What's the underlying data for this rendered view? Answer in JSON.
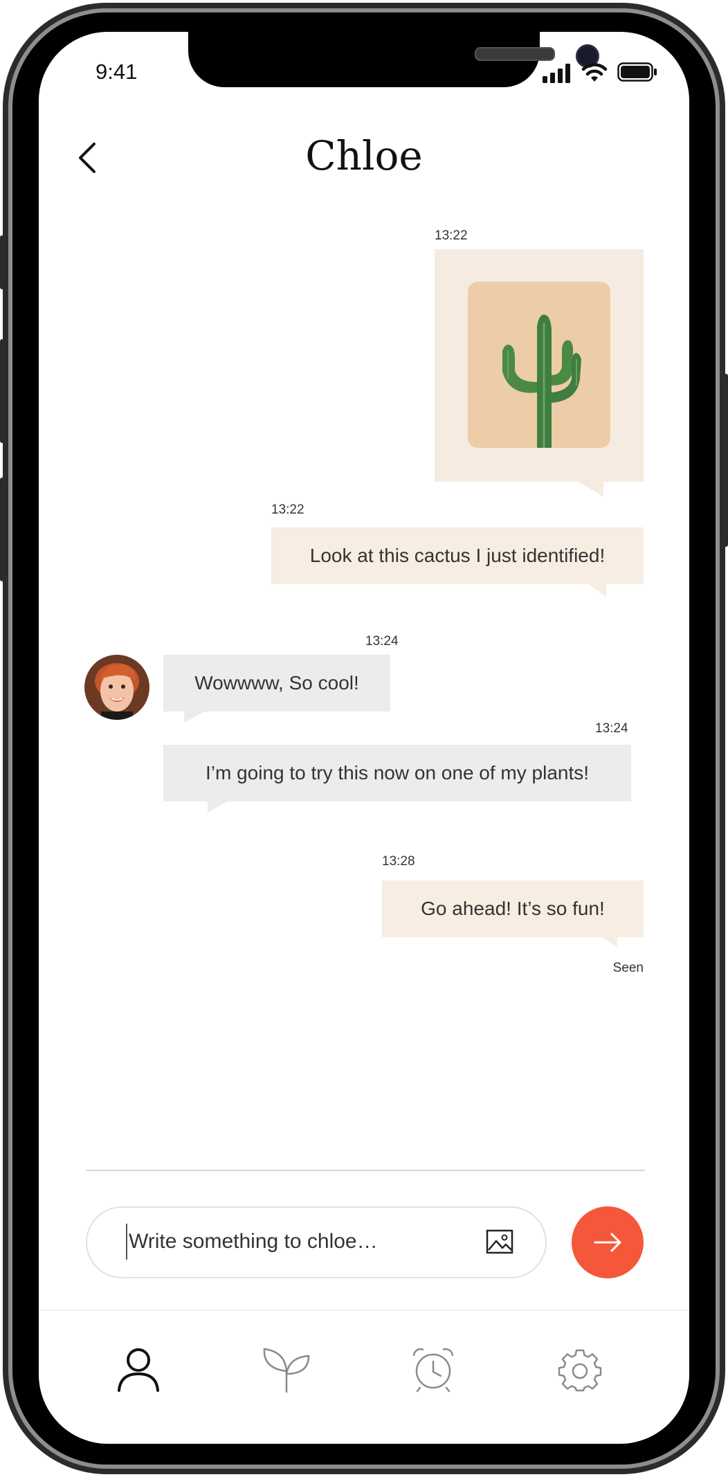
{
  "status_bar": {
    "time": "9:41"
  },
  "header": {
    "title": "Chloe",
    "back_icon": "chevron-left-icon"
  },
  "messages": [
    {
      "type": "image",
      "sender": "me",
      "time": "13:22",
      "image": "cactus-photo"
    },
    {
      "type": "text",
      "sender": "me",
      "time": "13:22",
      "text": "Look at this cactus I just identified!"
    },
    {
      "type": "text",
      "sender": "chloe",
      "time": "13:24",
      "text": "Wowwww, So cool!"
    },
    {
      "type": "text",
      "sender": "chloe",
      "time": "13:24",
      "text": "I’m going to try this now on one of my plants!"
    },
    {
      "type": "text",
      "sender": "me",
      "time": "13:28",
      "text": "Go ahead! It’s so fun!",
      "receipt": "Seen"
    }
  ],
  "composer": {
    "placeholder": "Write something to chloe…",
    "attach_icon": "image-icon",
    "send_icon": "arrow-right-icon"
  },
  "tab_bar": [
    {
      "icon": "user-icon",
      "active": true
    },
    {
      "icon": "plant-icon",
      "active": false
    },
    {
      "icon": "alarm-clock-icon",
      "active": false
    },
    {
      "icon": "gear-icon",
      "active": false
    }
  ],
  "colors": {
    "accent": "#f5573b",
    "outgoing_bubble": "#f7ede2",
    "incoming_bubble": "#ececec",
    "image_card": "#f6ebe0",
    "image_bg": "#eccda8"
  }
}
